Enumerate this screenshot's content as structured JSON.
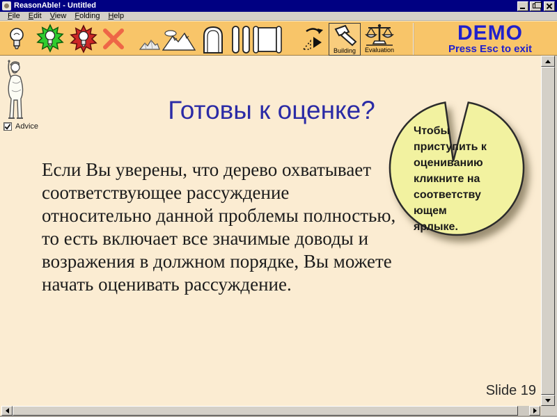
{
  "window": {
    "title": "ReasonAble! - Untitled",
    "controls": [
      "minimize",
      "restore",
      "close"
    ]
  },
  "menu": {
    "items": [
      "File",
      "Edit",
      "View",
      "Folding",
      "Help"
    ]
  },
  "toolbar": {
    "icons": [
      "lightbulb-icon",
      "lightbulb-green-burst-icon",
      "lightbulb-red-burst-icon",
      "delete-x-icon",
      "small-rocks-icon",
      "mountains-icon",
      "arch-icon",
      "closed-scroll-icon",
      "open-scroll-icon",
      "rotate-icon",
      "hammer-icon",
      "scales-icon"
    ],
    "building_label": "Building",
    "evaluation_label": "Evaluation",
    "demo_title": "DEMO",
    "demo_subtitle": "Press Esc to exit"
  },
  "sidebar": {
    "advice_label": "Advice",
    "advice_checked": "true"
  },
  "slide": {
    "title": "Готовы к оценке?",
    "body_lines": [
      "Если Вы уверены, что дерево охватывает",
      "соответствующее рассуждение",
      "относительно данной проблемы полностью,",
      "то есть включает все значимые доводы и",
      "возражения в должном порядке, Вы можете",
      "начать оценивать рассуждение."
    ],
    "callout_lines": [
      "Чтобы",
      "приступить к",
      "оцениванию",
      "кликните на",
      "соответству",
      "ющем",
      "ярлыке."
    ],
    "slide_number": "Slide 19"
  },
  "colors": {
    "titlebar_navy": "#000082",
    "toolbar_orange": "#f8c569",
    "slide_cream": "#fbecd2",
    "callout_yellow": "#f2f2a0",
    "demo_blue": "#2020cc",
    "title_blue": "#2b2ba6"
  }
}
